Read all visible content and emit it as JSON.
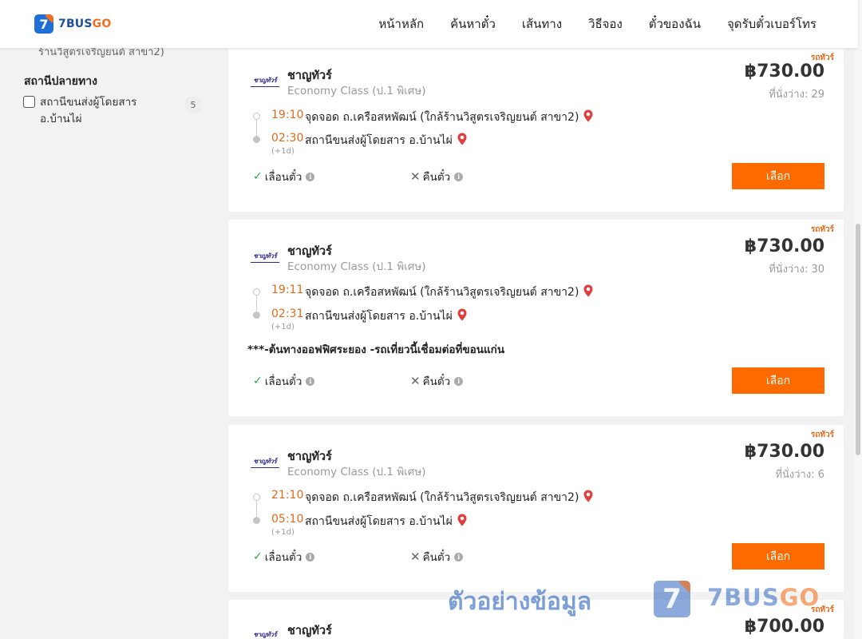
{
  "header": {
    "logo_num": "7",
    "logo_brand": "7BUS",
    "logo_go": "GO",
    "nav": [
      "หน้าหลัก",
      "ค้นหาตั๋ว",
      "เส้นทาง",
      "วิธีจอง",
      "ตั๋วของฉัน",
      "จุดรับตั๋วเบอร์โทร"
    ]
  },
  "sidebar": {
    "cut_text": "ร้านวิสูตรเจริญยนต์ สาขา2)",
    "section_title": "สถานีปลายทาง",
    "filter_label": "สถานีขนส่งผู้โดยสาร อ.บ้านไผ่",
    "filter_count": "5"
  },
  "trips": [
    {
      "tag": "รถทัวร์",
      "operator": "ชาญทัวร์",
      "operator_logo": "ชาญทัวร์",
      "bus_class": "Economy Class (ป.1 พิเศษ)",
      "price": "฿730.00",
      "seats": "ที่นั่งว่าง: 29",
      "depart_time": "19:10",
      "depart_stop": "จุดจอด ถ.เครือสหพัฒน์ (ใกล้ร้านวิสูตรเจริญยนต์ สาขา2)",
      "arrive_time": "02:30",
      "arrive_stop": "สถานีขนส่งผู้โดยสาร อ.บ้านไผ่",
      "next_day": "(+1d)",
      "note": "",
      "feature_reschedule": "เลื่อนตั๋ว",
      "feature_refund": "คืนตั๋ว",
      "select_label": "เลือก"
    },
    {
      "tag": "รถทัวร์",
      "operator": "ชาญทัวร์",
      "operator_logo": "ชาญทัวร์",
      "bus_class": "Economy Class (ป.1 พิเศษ)",
      "price": "฿730.00",
      "seats": "ที่นั่งว่าง: 30",
      "depart_time": "19:11",
      "depart_stop": "จุดจอด ถ.เครือสหพัฒน์ (ใกล้ร้านวิสูตรเจริญยนต์ สาขา2)",
      "arrive_time": "02:31",
      "arrive_stop": "สถานีขนส่งผู้โดยสาร อ.บ้านไผ่",
      "next_day": "(+1d)",
      "note": "***-ต้นทางออฟฟิศระยอง -รถเที่ยวนี้เชื่อมต่อที่ขอนแก่น",
      "feature_reschedule": "เลื่อนตั๋ว",
      "feature_refund": "คืนตั๋ว",
      "select_label": "เลือก"
    },
    {
      "tag": "รถทัวร์",
      "operator": "ชาญทัวร์",
      "operator_logo": "ชาญทัวร์",
      "bus_class": "Economy Class (ป.1 พิเศษ)",
      "price": "฿730.00",
      "seats": "ที่นั่งว่าง: 6",
      "depart_time": "21:10",
      "depart_stop": "จุดจอด ถ.เครือสหพัฒน์ (ใกล้ร้านวิสูตรเจริญยนต์ สาขา2)",
      "arrive_time": "05:10",
      "arrive_stop": "สถานีขนส่งผู้โดยสาร อ.บ้านไผ่",
      "next_day": "(+1d)",
      "note": "",
      "feature_reschedule": "เลื่อนตั๋ว",
      "feature_refund": "คืนตั๋ว",
      "select_label": "เลือก"
    },
    {
      "tag": "รถทัวร์",
      "operator": "ชาญทัวร์",
      "operator_logo": "ชาญทัวร์",
      "price": "฿700.00"
    }
  ],
  "watermark": {
    "text": "ตัวอย่างข้อมูล",
    "badge": "7",
    "brand": "7BUS",
    "brand_go": "GO"
  },
  "colors": {
    "accent": "#ff6a00",
    "time": "#e06a1b",
    "brand_blue": "#1f6fd6",
    "check": "#2ba84a"
  }
}
